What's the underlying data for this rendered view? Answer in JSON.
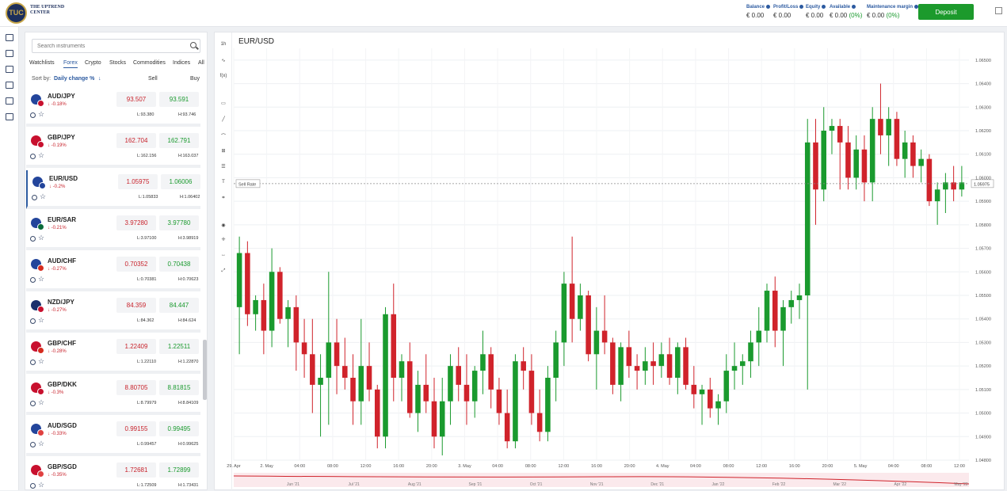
{
  "header": {
    "logo_text": "THE UPTREND CENTER",
    "account": [
      {
        "label": "Balance",
        "value": "€ 0.00"
      },
      {
        "label": "Profit/Loss",
        "value": "€ 0.00"
      },
      {
        "label": "Equity",
        "value": "€ 0.00"
      },
      {
        "label": "Available",
        "value": "€ 0.00",
        "pct": "(0%)"
      },
      {
        "label": "Maintenance margin",
        "value": "€ 0.00",
        "pct": "(0%)"
      }
    ],
    "deposit_label": "Deposit"
  },
  "instruments": {
    "search_placeholder": "Search instruments",
    "tabs": [
      "Watchlists",
      "Forex",
      "Crypto",
      "Stocks",
      "Commodities",
      "Indices",
      "All"
    ],
    "active_tab": "Forex",
    "sort_by_label": "Sort by:",
    "sort_value": "Daily change %",
    "sell_header": "Sell",
    "buy_header": "Buy",
    "items": [
      {
        "name": "AUD/JPY",
        "change": "-0.18%",
        "sell": "93.507",
        "buy": "93.591",
        "low": "L:93.380",
        "high": "H:93.746"
      },
      {
        "name": "GBP/JPY",
        "change": "-0.19%",
        "sell": "162.704",
        "buy": "162.791",
        "low": "L:162.156",
        "high": "H:163.037"
      },
      {
        "name": "EUR/USD",
        "change": "-0.2%",
        "sell": "1.05975",
        "buy": "1.06006",
        "low": "L:1.05833",
        "high": "H:1.06402"
      },
      {
        "name": "EUR/SAR",
        "change": "-0.21%",
        "sell": "3.97280",
        "buy": "3.97780",
        "low": "L:3.97100",
        "high": "H:3.98919"
      },
      {
        "name": "AUD/CHF",
        "change": "-0.27%",
        "sell": "0.70352",
        "buy": "0.70438",
        "low": "L:0.70381",
        "high": "H:0.70623"
      },
      {
        "name": "NZD/JPY",
        "change": "-0.27%",
        "sell": "84.359",
        "buy": "84.447",
        "low": "L:84.362",
        "high": "H:84.624"
      },
      {
        "name": "GBP/CHF",
        "change": "-0.28%",
        "sell": "1.22409",
        "buy": "1.22511",
        "low": "L:1.22110",
        "high": "H:1.22870"
      },
      {
        "name": "GBP/DKK",
        "change": "-0.3%",
        "sell": "8.80705",
        "buy": "8.81815",
        "low": "L:8.79979",
        "high": "H:8.84109"
      },
      {
        "name": "AUD/SGD",
        "change": "-0.33%",
        "sell": "0.99155",
        "buy": "0.99495",
        "low": "L:0.99457",
        "high": "H:0.99625"
      },
      {
        "name": "GBP/SGD",
        "change": "-0.35%",
        "sell": "1.72681",
        "buy": "1.72899",
        "low": "L:1.72509",
        "high": "H:1.73431"
      }
    ]
  },
  "chart": {
    "title": "EUR/USD",
    "toolbar": [
      "1h",
      "candles",
      "f(x)",
      "indicators",
      "line",
      "path",
      "crosshair",
      "fib",
      "text",
      "measure",
      "eye",
      "target",
      "zoom",
      "fullscreen"
    ],
    "sell_rate_label": "Sell Rate",
    "current_price_label": "1.05975",
    "colors": {
      "up": "#1a9a2e",
      "down": "#d0232b",
      "grid": "#eef0f3"
    }
  },
  "chart_data": {
    "type": "candlestick",
    "y_ticks": [
      "1.06500",
      "1.06400",
      "1.06300",
      "1.06200",
      "1.06100",
      "1.06000",
      "1.05900",
      "1.05800",
      "1.05700",
      "1.05600",
      "1.05500",
      "1.05400",
      "1.05300",
      "1.05200",
      "1.05100",
      "1.05000",
      "1.04900",
      "1.04800"
    ],
    "ylim": [
      1.048,
      1.0655
    ],
    "x_ticks": [
      "29. Apr",
      "2. May",
      "04:00",
      "08:00",
      "12:00",
      "16:00",
      "20:00",
      "3. May",
      "04:00",
      "08:00",
      "12:00",
      "16:00",
      "20:00",
      "4. May",
      "04:00",
      "08:00",
      "12:00",
      "16:00",
      "20:00",
      "5. May",
      "04:00",
      "08:00",
      "12:00"
    ],
    "navigator_ticks": [
      "Jun '21",
      "Jul '21",
      "Aug '21",
      "Sep '21",
      "Oct '21",
      "Nov '21",
      "Dec '21",
      "Jan '22",
      "Feb '22",
      "Mar '22",
      "Apr '22",
      "May '22"
    ],
    "candles": [
      [
        1.0545,
        1.0575,
        1.0525,
        1.0568
      ],
      [
        1.0568,
        1.0573,
        1.0537,
        1.0542
      ],
      [
        1.0542,
        1.055,
        1.0535,
        1.0548
      ],
      [
        1.0548,
        1.0555,
        1.0525,
        1.0535
      ],
      [
        1.0535,
        1.057,
        1.0528,
        1.056
      ],
      [
        1.056,
        1.0562,
        1.0538,
        1.054
      ],
      [
        1.054,
        1.0548,
        1.0528,
        1.0545
      ],
      [
        1.0545,
        1.055,
        1.0518,
        1.053
      ],
      [
        1.053,
        1.054,
        1.0515,
        1.0525
      ],
      [
        1.0525,
        1.054,
        1.05,
        1.0512
      ],
      [
        1.0512,
        1.0525,
        1.049,
        1.0515
      ],
      [
        1.0515,
        1.056,
        1.0495,
        1.053
      ],
      [
        1.053,
        1.054,
        1.0508,
        1.052
      ],
      [
        1.052,
        1.0532,
        1.051,
        1.0515
      ],
      [
        1.0515,
        1.0525,
        1.0495,
        1.0505
      ],
      [
        1.0505,
        1.054,
        1.0495,
        1.052
      ],
      [
        1.052,
        1.053,
        1.0505,
        1.051
      ],
      [
        1.051,
        1.0512,
        1.0485,
        1.049
      ],
      [
        1.049,
        1.0545,
        1.0485,
        1.0542
      ],
      [
        1.0542,
        1.0555,
        1.0505,
        1.0515
      ],
      [
        1.0515,
        1.0525,
        1.0505,
        1.0522
      ],
      [
        1.0522,
        1.053,
        1.0498,
        1.05
      ],
      [
        1.05,
        1.0518,
        1.0492,
        1.0512
      ],
      [
        1.0512,
        1.0525,
        1.05,
        1.0505
      ],
      [
        1.0505,
        1.0515,
        1.0485,
        1.049
      ],
      [
        1.049,
        1.0515,
        1.0482,
        1.0505
      ],
      [
        1.0505,
        1.0525,
        1.0495,
        1.052
      ],
      [
        1.052,
        1.0528,
        1.0505,
        1.0512
      ],
      [
        1.0512,
        1.0525,
        1.0495,
        1.0505
      ],
      [
        1.0505,
        1.052,
        1.0498,
        1.0518
      ],
      [
        1.0518,
        1.0535,
        1.0508,
        1.0525
      ],
      [
        1.0525,
        1.0528,
        1.0502,
        1.051
      ],
      [
        1.051,
        1.0515,
        1.0495,
        1.05
      ],
      [
        1.05,
        1.051,
        1.0485,
        1.0488
      ],
      [
        1.0488,
        1.0525,
        1.0485,
        1.0522
      ],
      [
        1.0522,
        1.0528,
        1.051,
        1.0518
      ],
      [
        1.0518,
        1.0525,
        1.0495,
        1.05
      ],
      [
        1.05,
        1.051,
        1.0488,
        1.0492
      ],
      [
        1.0492,
        1.052,
        1.0488,
        1.0515
      ],
      [
        1.0515,
        1.0535,
        1.0505,
        1.053
      ],
      [
        1.053,
        1.056,
        1.052,
        1.0555
      ],
      [
        1.0555,
        1.0575,
        1.053,
        1.054
      ],
      [
        1.054,
        1.0555,
        1.0535,
        1.055
      ],
      [
        1.055,
        1.0552,
        1.0522,
        1.0525
      ],
      [
        1.0525,
        1.0545,
        1.051,
        1.0535
      ],
      [
        1.0535,
        1.055,
        1.0525,
        1.053
      ],
      [
        1.053,
        1.0532,
        1.0508,
        1.0512
      ],
      [
        1.0512,
        1.053,
        1.0505,
        1.0528
      ],
      [
        1.0528,
        1.0535,
        1.0515,
        1.052
      ],
      [
        1.052,
        1.0525,
        1.051,
        1.0518
      ],
      [
        1.0518,
        1.0528,
        1.0512,
        1.0522
      ],
      [
        1.0522,
        1.053,
        1.0512,
        1.052
      ],
      [
        1.052,
        1.053,
        1.0515,
        1.0525
      ],
      [
        1.0525,
        1.0532,
        1.0512,
        1.0515
      ],
      [
        1.0515,
        1.053,
        1.0508,
        1.0528
      ],
      [
        1.0528,
        1.0532,
        1.051,
        1.0512
      ],
      [
        1.0512,
        1.052,
        1.0502,
        1.0508
      ],
      [
        1.0508,
        1.0512,
        1.0495,
        1.051
      ],
      [
        1.051,
        1.0515,
        1.0498,
        1.0502
      ],
      [
        1.0502,
        1.0508,
        1.0495,
        1.0505
      ],
      [
        1.0505,
        1.0525,
        1.05,
        1.0518
      ],
      [
        1.0518,
        1.053,
        1.051,
        1.052
      ],
      [
        1.052,
        1.0525,
        1.0512,
        1.0522
      ],
      [
        1.0522,
        1.0535,
        1.0515,
        1.053
      ],
      [
        1.053,
        1.0545,
        1.052,
        1.0535
      ],
      [
        1.0535,
        1.0555,
        1.053,
        1.0552
      ],
      [
        1.0552,
        1.0558,
        1.0528,
        1.0535
      ],
      [
        1.0535,
        1.0548,
        1.052,
        1.0545
      ],
      [
        1.0545,
        1.0552,
        1.0538,
        1.0548
      ],
      [
        1.0548,
        1.0555,
        1.054,
        1.055
      ],
      [
        1.055,
        1.0625,
        1.051,
        1.0615
      ],
      [
        1.0615,
        1.0625,
        1.058,
        1.0595
      ],
      [
        1.0595,
        1.063,
        1.059,
        1.062
      ],
      [
        1.062,
        1.0625,
        1.061,
        1.0622
      ],
      [
        1.0622,
        1.0625,
        1.0595,
        1.0615
      ],
      [
        1.0615,
        1.0622,
        1.0595,
        1.06
      ],
      [
        1.06,
        1.0618,
        1.0595,
        1.0612
      ],
      [
        1.0612,
        1.0618,
        1.059,
        1.0598
      ],
      [
        1.0598,
        1.063,
        1.059,
        1.0625
      ],
      [
        1.0625,
        1.064,
        1.061,
        1.0618
      ],
      [
        1.0618,
        1.063,
        1.0605,
        1.0625
      ],
      [
        1.0625,
        1.0628,
        1.0605,
        1.0608
      ],
      [
        1.0608,
        1.062,
        1.06,
        1.0615
      ],
      [
        1.0615,
        1.0618,
        1.06,
        1.0605
      ],
      [
        1.0605,
        1.0612,
        1.0598,
        1.0608
      ],
      [
        1.0608,
        1.061,
        1.0588,
        1.059
      ],
      [
        1.059,
        1.0598,
        1.058,
        1.0595
      ],
      [
        1.0595,
        1.0602,
        1.0585,
        1.0598
      ],
      [
        1.0598,
        1.0605,
        1.059,
        1.0595
      ],
      [
        1.0595,
        1.0605,
        1.0592,
        1.0598
      ]
    ],
    "current_price": 1.05975
  }
}
